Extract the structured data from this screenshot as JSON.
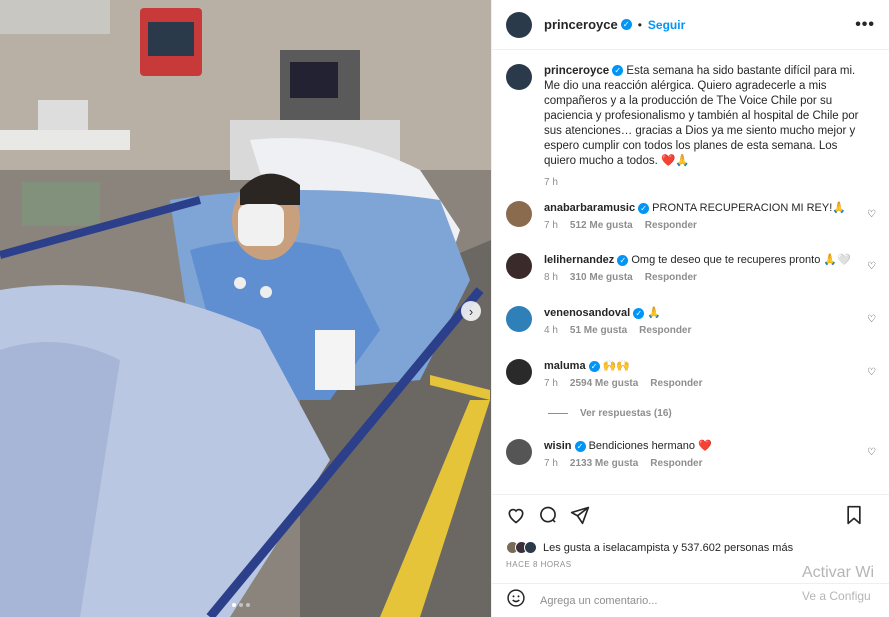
{
  "post": {
    "username": "princeroyce",
    "follow_label": "Seguir",
    "bullet": "•",
    "more_label": "•••"
  },
  "caption": {
    "username": "princeroyce",
    "text": "Esta semana ha sido bastante difícil para mi. Me dio una reacción alérgica. Quiero agradecerle a mis compañeros y a la producción de The Voice Chile por su paciencia y profesionalismo y también al hospital de Chile por sus atenciones… gracias a Dios ya me siento mucho mejor y espero cumplir con todos los planes de esta semana. Los quiero mucho a todos. ❤️🙏",
    "time": "7 h"
  },
  "comments": [
    {
      "user": "anabarbaramusic",
      "text": "PRONTA RECUPERACION MI REY!🙏",
      "time": "7 h",
      "likes": "512 Me gusta",
      "reply": "Responder",
      "avatar_color": "#8b6b4e"
    },
    {
      "user": "lelihernandez",
      "text": "Omg te deseo que te recuperes pronto 🙏🤍",
      "time": "8 h",
      "likes": "310 Me gusta",
      "reply": "Responder",
      "avatar_color": "#3a2a2a"
    },
    {
      "user": "venenosandoval",
      "text": "🙏",
      "time": "4 h",
      "likes": "51 Me gusta",
      "reply": "Responder",
      "avatar_color": "#2f7fb8"
    },
    {
      "user": "maluma",
      "text": "🙌🙌",
      "time": "7 h",
      "likes": "2594 Me gusta",
      "reply": "Responder",
      "avatar_color": "#2a2a2a"
    },
    {
      "user": "wisin",
      "text": "Bendiciones hermano ❤️",
      "time": "7 h",
      "likes": "2133 Me gusta",
      "reply": "Responder",
      "avatar_color": "#555555"
    }
  ],
  "view_replies": "Ver respuestas (16)",
  "likes_summary": "Les gusta a iselacampista y 537.602 personas más",
  "date": "HACE 8 HORAS",
  "add_comment": {
    "placeholder": "Agrega un comentario..."
  },
  "watermark": {
    "line1": "Activar Wi",
    "line2": "Ve a Configu"
  },
  "icons": {
    "heart": "heart-icon",
    "comment": "comment-icon",
    "share": "share-icon",
    "save": "bookmark-icon",
    "emoji": "emoji-icon",
    "next": "chevron-right-icon"
  },
  "colors": {
    "accent": "#0095f6",
    "like": "#ed4956"
  }
}
